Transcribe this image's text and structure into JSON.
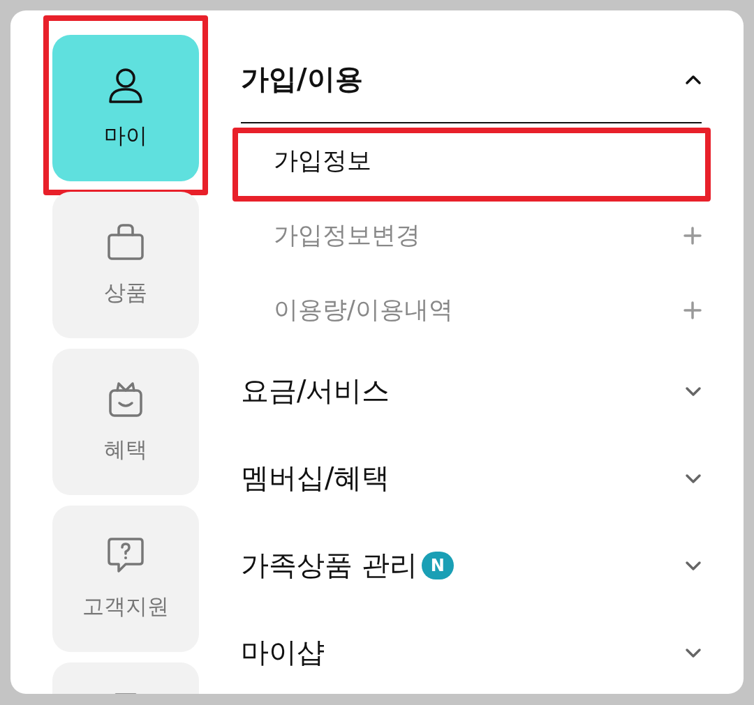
{
  "sidebar": {
    "items": [
      {
        "label": "마이",
        "selected": true,
        "highlighted": true
      },
      {
        "label": "상품",
        "selected": false,
        "highlighted": false
      },
      {
        "label": "혜택",
        "selected": false,
        "highlighted": false
      },
      {
        "label": "고객지원",
        "selected": false,
        "highlighted": false
      },
      {
        "selected": false,
        "highlighted": false
      }
    ]
  },
  "menu": {
    "sections": [
      {
        "title": "가입/이용",
        "expanded": true,
        "children": [
          {
            "label": "가입정보",
            "selected": true,
            "highlighted": true,
            "has_children": false
          },
          {
            "label": "가입정보변경",
            "selected": false,
            "highlighted": false,
            "has_children": true
          },
          {
            "label": "이용량/이용내역",
            "selected": false,
            "highlighted": false,
            "has_children": true
          }
        ]
      },
      {
        "title": "요금/서비스",
        "expanded": false
      },
      {
        "title": "멤버십/혜택",
        "expanded": false
      },
      {
        "title": "가족상품 관리",
        "expanded": false,
        "badge": "N"
      },
      {
        "title": "마이샵",
        "expanded": false
      }
    ]
  }
}
